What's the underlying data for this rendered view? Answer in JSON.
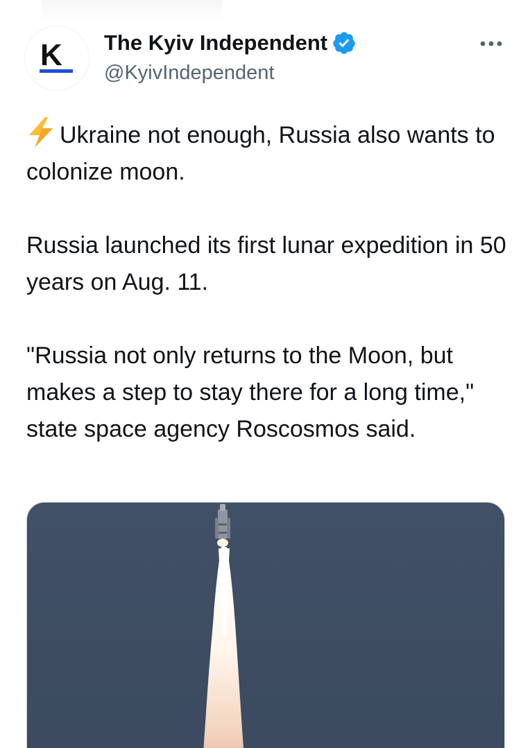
{
  "author": {
    "name": "The Kyiv Independent",
    "handle": "@KyivIndependent",
    "avatar_letter": "K",
    "verified": true,
    "verified_color": "#1d9bf0",
    "brand_accent": "#1d4ed8"
  },
  "more_icon": "more-options-icon",
  "tweet": {
    "headline_icon": "lightning-icon",
    "paragraphs": [
      "Ukraine not enough, Russia also wants to colonize moon.",
      "Russia launched its first lunar expedition in 50 years on Aug. 11.",
      "\"Russia not only returns to the Moon, but makes a step to stay there for a long time,\" state space agency Roscosmos said."
    ]
  },
  "media": {
    "sky_color": "#3f4e64"
  }
}
